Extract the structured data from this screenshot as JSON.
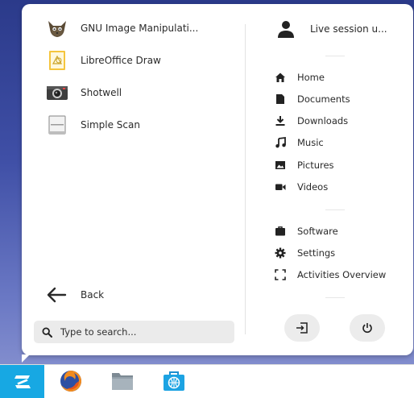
{
  "apps": [
    {
      "label": "GNU Image Manipulati...",
      "icon": "gimp-icon"
    },
    {
      "label": "LibreOffice Draw",
      "icon": "libreoffice-draw-icon"
    },
    {
      "label": "Shotwell",
      "icon": "shotwell-icon"
    },
    {
      "label": "Simple Scan",
      "icon": "simple-scan-icon"
    }
  ],
  "back_label": "Back",
  "search": {
    "placeholder": "Type to search..."
  },
  "user": {
    "label": "Live session u...",
    "icon": "user-icon"
  },
  "places": [
    {
      "label": "Home",
      "icon": "home-icon"
    },
    {
      "label": "Documents",
      "icon": "documents-icon"
    },
    {
      "label": "Downloads",
      "icon": "downloads-icon"
    },
    {
      "label": "Music",
      "icon": "music-icon"
    },
    {
      "label": "Pictures",
      "icon": "pictures-icon"
    },
    {
      "label": "Videos",
      "icon": "videos-icon"
    }
  ],
  "system": [
    {
      "label": "Software",
      "icon": "software-icon"
    },
    {
      "label": "Settings",
      "icon": "settings-icon"
    },
    {
      "label": "Activities Overview",
      "icon": "activities-overview-icon"
    }
  ],
  "session_buttons": [
    {
      "icon": "logout-icon"
    },
    {
      "icon": "power-icon"
    }
  ],
  "taskbar": {
    "accent_color": "#17a8e3",
    "items": [
      {
        "icon": "zorin-menu-icon"
      },
      {
        "icon": "firefox-icon"
      },
      {
        "icon": "files-icon"
      },
      {
        "icon": "software-store-icon"
      }
    ]
  }
}
